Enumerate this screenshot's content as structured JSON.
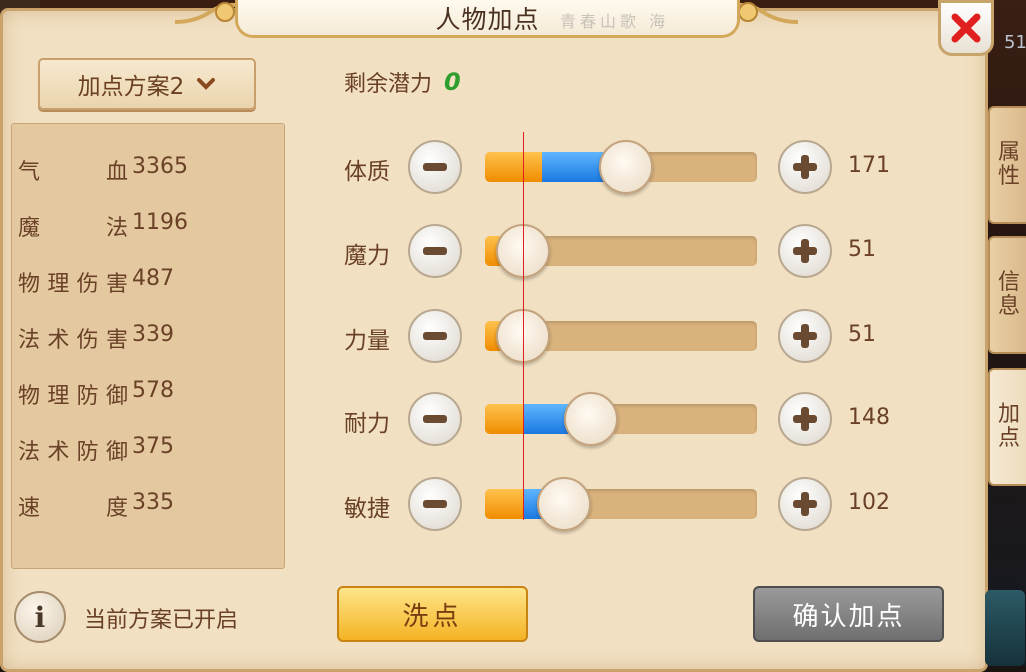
{
  "title": "人物加点",
  "ink_deco_text": "青春山歌 海",
  "right_edge_number": "51",
  "scheme_button": {
    "label": "加点方案2"
  },
  "stats": [
    {
      "label": "气血",
      "value": "3365"
    },
    {
      "label": "魔法",
      "value": "1196"
    },
    {
      "label": "物理伤害",
      "value": "487"
    },
    {
      "label": "法术伤害",
      "value": "339"
    },
    {
      "label": "物理防御",
      "value": "578"
    },
    {
      "label": "法术防御",
      "value": "375"
    },
    {
      "label": "速度",
      "value": "335"
    }
  ],
  "info": {
    "icon_text": "i",
    "text": "当前方案已开启"
  },
  "remaining": {
    "label": "剩余潜力",
    "value": "0"
  },
  "attributes": [
    {
      "label": "体质",
      "value": "171",
      "base_fraction": 0.21,
      "fill_fraction": 0.52
    },
    {
      "label": "魔力",
      "value": "51",
      "base_fraction": 0.14,
      "fill_fraction": 0.14
    },
    {
      "label": "力量",
      "value": "51",
      "base_fraction": 0.14,
      "fill_fraction": 0.14
    },
    {
      "label": "耐力",
      "value": "148",
      "base_fraction": 0.14,
      "fill_fraction": 0.39
    },
    {
      "label": "敏捷",
      "value": "102",
      "base_fraction": 0.14,
      "fill_fraction": 0.29
    }
  ],
  "buttons": {
    "wash": "洗点",
    "confirm": "确认加点"
  },
  "side_tabs": [
    {
      "label": "属性",
      "chars": [
        "属",
        "性"
      ]
    },
    {
      "label": "信息",
      "chars": [
        "信",
        "息"
      ]
    },
    {
      "label": "加点",
      "chars": [
        "加",
        "点"
      ],
      "active": true
    }
  ],
  "colors": {
    "panel_bg": "#f1e0c2",
    "text_brown": "#6a4127",
    "base_fill": "#f08c00",
    "added_fill": "#1a78e0",
    "remaining_green": "#2e9e2e",
    "close_red": "#e0201f"
  }
}
